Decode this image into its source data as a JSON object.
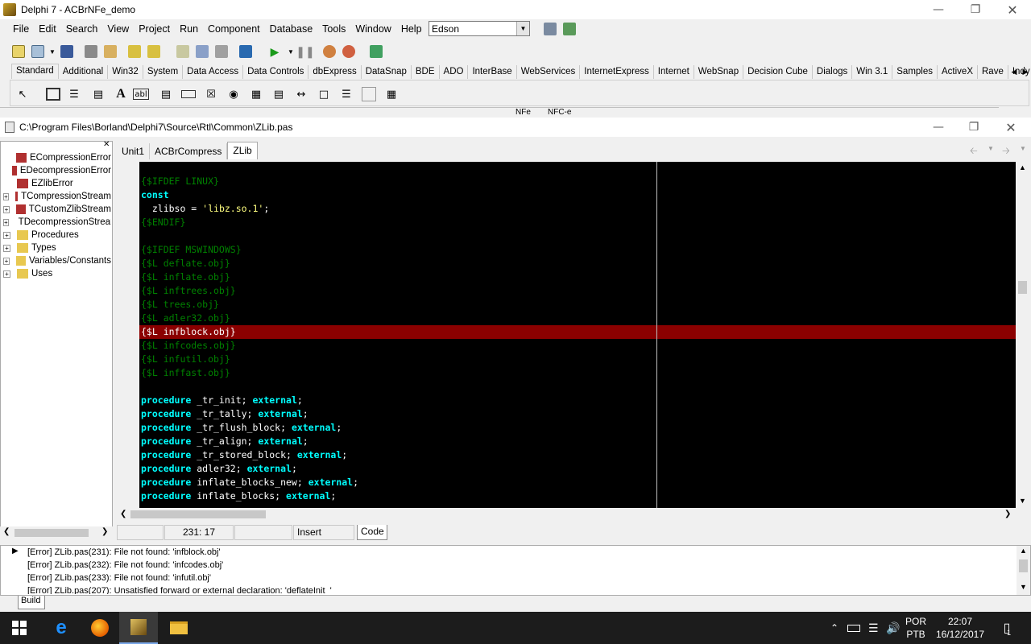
{
  "window": {
    "title": "Delphi 7 - ACBrNFe_demo",
    "min_icon": "minimize-icon",
    "max_icon": "restore-icon",
    "close_icon": "close-icon"
  },
  "menu": [
    "File",
    "Edit",
    "Search",
    "View",
    "Project",
    "Run",
    "Component",
    "Database",
    "Tools",
    "Window",
    "Help"
  ],
  "desktop_combo": {
    "value": "Edson"
  },
  "palette_tabs": [
    "Standard",
    "Additional",
    "Win32",
    "System",
    "Data Access",
    "Data Controls",
    "dbExpress",
    "DataSnap",
    "BDE",
    "ADO",
    "InterBase",
    "WebServices",
    "InternetExpress",
    "Internet",
    "WebSnap",
    "Decision Cube",
    "Dialogs",
    "Win 3.1",
    "Samples",
    "ActiveX",
    "Rave",
    "Indy C"
  ],
  "palette_active": "Standard",
  "palette_components": [
    "A",
    "abl"
  ],
  "behind_labels": [
    "NFe",
    "NFC-e"
  ],
  "editor": {
    "title": "C:\\Program Files\\Borland\\Delphi7\\Source\\Rtl\\Common\\ZLib.pas",
    "tabs": [
      "Unit1",
      "ACBrCompress",
      "ZLib"
    ],
    "active_tab": "ZLib"
  },
  "explorer": [
    {
      "label": "ECompressionError",
      "expandable": false
    },
    {
      "label": "EDecompressionError",
      "expandable": false
    },
    {
      "label": "EZlibError",
      "expandable": false
    },
    {
      "label": "TCompressionStream",
      "expandable": true
    },
    {
      "label": "TCustomZlibStream",
      "expandable": true
    },
    {
      "label": "TDecompressionStream",
      "expandable": true
    },
    {
      "label": "Procedures",
      "expandable": true
    },
    {
      "label": "Types",
      "expandable": true
    },
    {
      "label": "Variables/Constants",
      "expandable": true
    },
    {
      "label": "Uses",
      "expandable": true
    }
  ],
  "code_lines": [
    [
      [
        "dir",
        "{$IFDEF LINUX}"
      ]
    ],
    [
      [
        "kw",
        "const"
      ]
    ],
    [
      [
        "id",
        "  zlibso = "
      ],
      [
        "str",
        "'libz.so.1'"
      ],
      [
        "id",
        ";"
      ]
    ],
    [
      [
        "dir",
        "{$ENDIF}"
      ]
    ],
    [],
    [
      [
        "dir",
        "{$IFDEF MSWINDOWS}"
      ]
    ],
    [
      [
        "dir",
        "{$L deflate.obj}"
      ]
    ],
    [
      [
        "dir",
        "{$L inflate.obj}"
      ]
    ],
    [
      [
        "dir",
        "{$L inftrees.obj}"
      ]
    ],
    [
      [
        "dir",
        "{$L trees.obj}"
      ]
    ],
    [
      [
        "dir",
        "{$L adler32.obj}"
      ]
    ],
    [
      [
        "dir",
        "{$L infblock.obj}"
      ]
    ],
    [
      [
        "dir",
        "{$L infcodes.obj}"
      ]
    ],
    [
      [
        "dir",
        "{$L infutil.obj}"
      ]
    ],
    [
      [
        "dir",
        "{$L inffast.obj}"
      ]
    ],
    [],
    [
      [
        "kw",
        "procedure"
      ],
      [
        "id",
        " _tr_init; "
      ],
      [
        "kw",
        "external"
      ],
      [
        "id",
        ";"
      ]
    ],
    [
      [
        "kw",
        "procedure"
      ],
      [
        "id",
        " _tr_tally; "
      ],
      [
        "kw",
        "external"
      ],
      [
        "id",
        ";"
      ]
    ],
    [
      [
        "kw",
        "procedure"
      ],
      [
        "id",
        " _tr_flush_block; "
      ],
      [
        "kw",
        "external"
      ],
      [
        "id",
        ";"
      ]
    ],
    [
      [
        "kw",
        "procedure"
      ],
      [
        "id",
        " _tr_align; "
      ],
      [
        "kw",
        "external"
      ],
      [
        "id",
        ";"
      ]
    ],
    [
      [
        "kw",
        "procedure"
      ],
      [
        "id",
        " _tr_stored_block; "
      ],
      [
        "kw",
        "external"
      ],
      [
        "id",
        ";"
      ]
    ],
    [
      [
        "kw",
        "procedure"
      ],
      [
        "id",
        " adler32; "
      ],
      [
        "kw",
        "external"
      ],
      [
        "id",
        ";"
      ]
    ],
    [
      [
        "kw",
        "procedure"
      ],
      [
        "id",
        " inflate_blocks_new; "
      ],
      [
        "kw",
        "external"
      ],
      [
        "id",
        ";"
      ]
    ],
    [
      [
        "kw",
        "procedure"
      ],
      [
        "id",
        " inflate_blocks; "
      ],
      [
        "kw",
        "external"
      ],
      [
        "id",
        ";"
      ]
    ]
  ],
  "error_line_index": 11,
  "status": {
    "position": "231:  17",
    "mode": "Insert",
    "tab": "Code"
  },
  "messages": [
    "[Error] ZLib.pas(231): File not found: 'infblock.obj'",
    "[Error] ZLib.pas(232): File not found: 'infcodes.obj'",
    "[Error] ZLib.pas(233): File not found: 'infutil.obj'",
    "[Error] ZLib.pas(207): Unsatisfied forward or external declaration: 'deflateInit_'"
  ],
  "messages_tab": "Build",
  "taskbar": {
    "lang1": "POR",
    "lang2": "PTB",
    "time": "22:07",
    "date": "16/12/2017",
    "notif_count": "1"
  },
  "colors": {
    "code_bg": "#000000",
    "keyword": "#00ffff",
    "directive": "#008000",
    "string": "#ffff80",
    "error_bg": "#8b0000"
  }
}
